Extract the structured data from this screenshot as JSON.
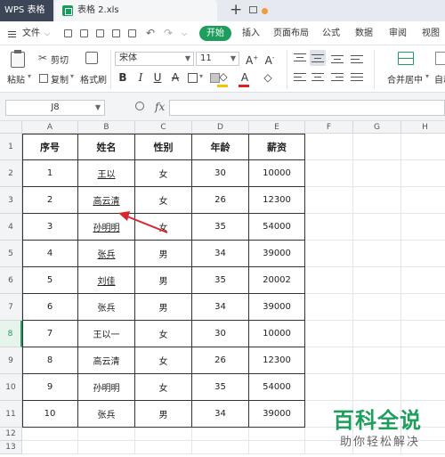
{
  "titlebar": {
    "app_tab": "WPS 表格",
    "file_tab": "表格 2.xls"
  },
  "menubar": {
    "file": "文件",
    "start": "开始",
    "tabs": [
      "插入",
      "页面布局",
      "公式",
      "数据",
      "审阅",
      "视图"
    ]
  },
  "ribbon": {
    "paste": "粘贴",
    "cut": "剪切",
    "copy": "复制",
    "format_painter": "格式刷",
    "font_name": "宋体",
    "font_size": "11",
    "merge_center": "合并居中",
    "auto_wrap": "自动"
  },
  "formula_bar": {
    "name_box": "J8",
    "fx": "fx",
    "content": ""
  },
  "grid": {
    "columns": [
      "A",
      "B",
      "C",
      "D",
      "E",
      "F",
      "G",
      "H"
    ],
    "rows": [
      "1",
      "2",
      "3",
      "4",
      "5",
      "6",
      "7",
      "8",
      "9",
      "10",
      "11",
      "12",
      "13"
    ],
    "active_row": "8",
    "table_header": [
      "序号",
      "姓名",
      "性别",
      "年龄",
      "薪资"
    ],
    "table_rows": [
      [
        "1",
        "王以",
        "女",
        "30",
        "10000"
      ],
      [
        "2",
        "高云清",
        "女",
        "26",
        "12300"
      ],
      [
        "3",
        "孙明明",
        "女",
        "35",
        "54000"
      ],
      [
        "4",
        "张兵",
        "男",
        "34",
        "39000"
      ],
      [
        "5",
        "刘佳",
        "男",
        "35",
        "20002"
      ],
      [
        "6",
        "张兵",
        "男",
        "34",
        "39000"
      ],
      [
        "7",
        "王以一",
        "女",
        "30",
        "10000"
      ],
      [
        "8",
        "高云清",
        "女",
        "26",
        "12300"
      ],
      [
        "9",
        "孙明明",
        "女",
        "35",
        "54000"
      ],
      [
        "10",
        "张兵",
        "男",
        "34",
        "39000"
      ]
    ],
    "underlined_name_rows": [
      0,
      1,
      2,
      3,
      4
    ]
  },
  "annotation": {
    "arrow_color": "#d9262c"
  },
  "watermark": {
    "title": "百科全说",
    "subtitle": "助你轻松解决"
  },
  "colors": {
    "accent": "#1e9e5c",
    "titlebar": "#3d4656"
  }
}
